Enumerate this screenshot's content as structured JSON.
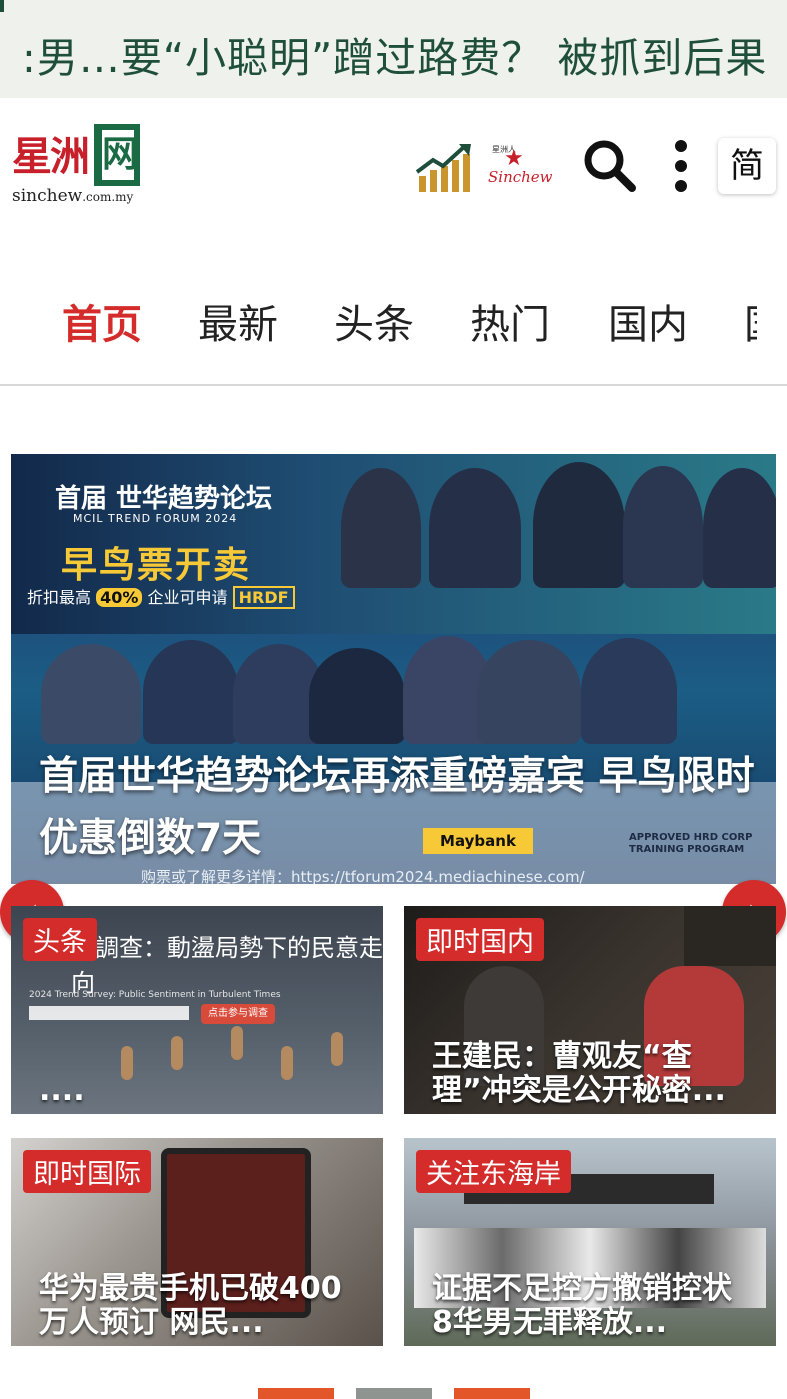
{
  "ticker": {
    "text": ":男…要“小聪明”蹭过路费？ 被抓到后果"
  },
  "header": {
    "logo_cn": "星洲",
    "logo_book": "网",
    "logo_en": "sinchew",
    "logo_domain": ".com.my",
    "sinchew_small_caps": "星洲人",
    "sinchew_word": "Sinchew",
    "lang_label": "简"
  },
  "nav": {
    "items": [
      {
        "label": "首页",
        "active": true
      },
      {
        "label": "最新"
      },
      {
        "label": "头条"
      },
      {
        "label": "热门"
      },
      {
        "label": "国内"
      },
      {
        "label": "国"
      }
    ]
  },
  "hero": {
    "forum_cn": "首届 世华趋势论坛",
    "forum_en": "MCIL TREND FORUM 2024",
    "early_bird": "早鸟票开卖",
    "discount_prefix": "折扣最高",
    "discount_pct": "40%",
    "discount_mid": "企业可申请",
    "discount_tag": "HRDF",
    "sponsor": "Maybank",
    "hrd_note": "APPROVED HRD CORP TRAINING PROGRAM",
    "url": "购票或了解更多详情：https://tforum2024.mediachinese.com/",
    "title": "首届世华趋势论坛再添重磅嘉宾 早鸟限时优惠倒数7天"
  },
  "carousel": {
    "prev_icon": "‹",
    "next_icon": "›"
  },
  "cards": [
    {
      "badge": "头条",
      "title": "....",
      "overlay_text": "勢調查：動盪局勢下的民意走向",
      "overlay_sub": "2024 Trend Survey: Public Sentiment in Turbulent Times",
      "overlay_btn": "点击参与调查"
    },
    {
      "badge": "即时国内",
      "title": "王建民：曹观友“查理”冲突是公开秘密..."
    },
    {
      "badge": "即时国际",
      "title": "华为最贵手机已破400万人预订 网民..."
    },
    {
      "badge": "关注东海岸",
      "title": "证据不足控方撤销控状 8华男无罪释放..."
    }
  ],
  "colors": {
    "accent_red": "#d42b2b",
    "brand_green": "#1a6b43",
    "ticker_text": "#1f4f3b"
  }
}
